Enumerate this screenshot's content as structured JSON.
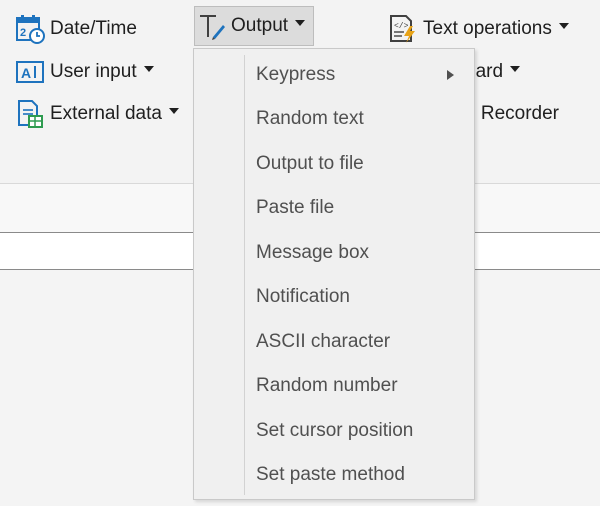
{
  "ribbon": {
    "datetime_label": "Date/Time",
    "userinput_label": "User input",
    "externaldata_label": "External data",
    "output_label": "Output",
    "textops_label": "Text operations",
    "clipboard_partial_label": "oard",
    "recorder_partial_label": "o Recorder"
  },
  "menu": {
    "items": [
      {
        "label": "Keypress",
        "has_submenu": true
      },
      {
        "label": "Random text"
      },
      {
        "label": "Output to file"
      },
      {
        "label": "Paste file"
      },
      {
        "label": "Message box"
      },
      {
        "label": "Notification"
      },
      {
        "label": "ASCII character"
      },
      {
        "label": "Random number"
      },
      {
        "label": "Set cursor position"
      },
      {
        "label": "Set paste method"
      }
    ]
  },
  "colors": {
    "accent": "#1e73be",
    "accent_green": "#2e9b4f",
    "accent_orange": "#e8a317"
  },
  "icons": {
    "datetime": "calendar-clock-icon",
    "userinput": "text-input-icon",
    "externaldata": "document-table-icon",
    "output": "text-cursor-pen-icon",
    "textops": "code-lightning-icon"
  }
}
